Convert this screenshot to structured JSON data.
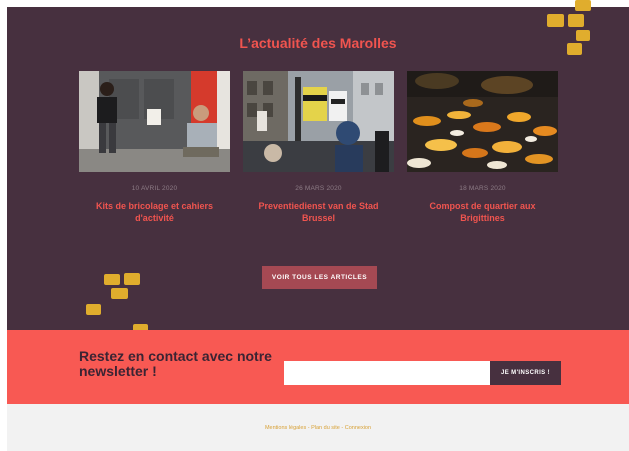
{
  "news": {
    "title": "L’actualité des Marolles",
    "articles": [
      {
        "date": "10 avril 2020",
        "title": "Kits de bricolage et cahiers d'activité"
      },
      {
        "date": "26 mars 2020",
        "title": "Preventiedienst van de Stad Brussel"
      },
      {
        "date": "18 mars 2020",
        "title": "Compost de quartier aux Brigittines"
      }
    ],
    "all_button": "VOIR TOUS LES ARTICLES"
  },
  "newsletter": {
    "heading": "Restez en contact avec notre newsletter !",
    "email_value": "",
    "submit_label": "JE M'INSCRIS !"
  },
  "footer": {
    "links": [
      "Mentions légales",
      "Plan du site",
      "Connexion"
    ],
    "separator": " - "
  },
  "colors": {
    "news_bg": "#47303f",
    "accent_red": "#f0544f",
    "newsletter_bg": "#f85953",
    "deco_yellow": "#e0ad2d",
    "button_bg": "#a54953"
  }
}
